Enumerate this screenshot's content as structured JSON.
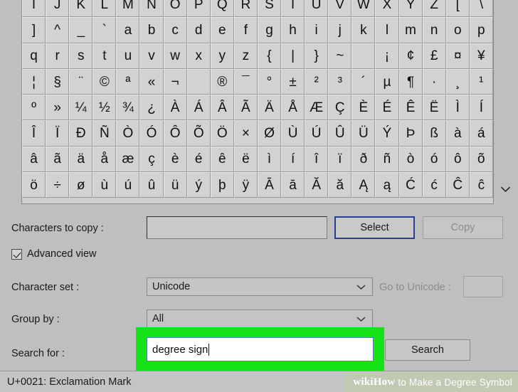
{
  "app": {
    "name": "Character Map"
  },
  "grid": {
    "rows": [
      [
        "I",
        "J",
        "K",
        "L",
        "M",
        "N",
        "O",
        "P",
        "Q",
        "R",
        "S",
        "T",
        "U",
        "V",
        "W",
        "X",
        "Y",
        "Z",
        "[",
        "\\"
      ],
      [
        "]",
        "^",
        "_",
        "`",
        "a",
        "b",
        "c",
        "d",
        "e",
        "f",
        "g",
        "h",
        "i",
        "j",
        "k",
        "l",
        "m",
        "n",
        "o",
        "p"
      ],
      [
        "q",
        "r",
        "s",
        "t",
        "u",
        "v",
        "w",
        "x",
        "y",
        "z",
        "{",
        "|",
        "}",
        "~",
        " ",
        "¡",
        "¢",
        "£",
        "¤",
        "¥"
      ],
      [
        "¦",
        "§",
        "¨",
        "©",
        "ª",
        "«",
        "¬",
        "­",
        "®",
        "¯",
        "°",
        "±",
        "²",
        "³",
        "´",
        "µ",
        "¶",
        "·",
        "¸",
        "¹"
      ],
      [
        "º",
        "»",
        "¼",
        "½",
        "¾",
        "¿",
        "À",
        "Á",
        "Â",
        "Ã",
        "Ä",
        "Å",
        "Æ",
        "Ç",
        "È",
        "É",
        "Ê",
        "Ë",
        "Ì",
        "Í"
      ],
      [
        "Î",
        "Ï",
        "Ð",
        "Ñ",
        "Ò",
        "Ó",
        "Ô",
        "Õ",
        "Ö",
        "×",
        "Ø",
        "Ù",
        "Ú",
        "Û",
        "Ü",
        "Ý",
        "Þ",
        "ß",
        "à",
        "á"
      ],
      [
        "â",
        "ã",
        "ä",
        "å",
        "æ",
        "ç",
        "è",
        "é",
        "ê",
        "ë",
        "ì",
        "í",
        "î",
        "ï",
        "ð",
        "ñ",
        "ò",
        "ó",
        "ô",
        "õ"
      ],
      [
        "ö",
        "÷",
        "ø",
        "ù",
        "ú",
        "û",
        "ü",
        "ý",
        "þ",
        "ÿ",
        "Ā",
        "ā",
        "Ă",
        "ă",
        "Ą",
        "ą",
        "Ć",
        "ć",
        "Ĉ",
        "ĉ"
      ]
    ],
    "scroll_down_icon": "chevron-down-icon"
  },
  "form": {
    "chars_to_copy_label": "Characters to copy :",
    "chars_to_copy_value": "",
    "select_button": "Select",
    "copy_button": "Copy",
    "advanced_view_label": "Advanced view",
    "advanced_view_checked": true,
    "character_set_label": "Character set :",
    "character_set_value": "Unicode",
    "goto_unicode_label": "Go to Unicode :",
    "goto_unicode_value": "",
    "group_by_label": "Group by :",
    "group_by_value": "All",
    "search_for_label": "Search for :",
    "search_for_value": "degree sign",
    "search_button": "Search",
    "dropdown_icon": "chevron-down-icon"
  },
  "status": {
    "text": "U+0021: Exclamation Mark"
  },
  "watermark": {
    "brand_wiki": "wiki",
    "brand_how": "How",
    "caption": "to Make a Degree Symbol"
  },
  "colors": {
    "highlight_green": "#16e316",
    "focus_blue": "#2b3f8c",
    "window_bg": "#bfbfbf",
    "cell_bg": "#d2d2d2"
  }
}
